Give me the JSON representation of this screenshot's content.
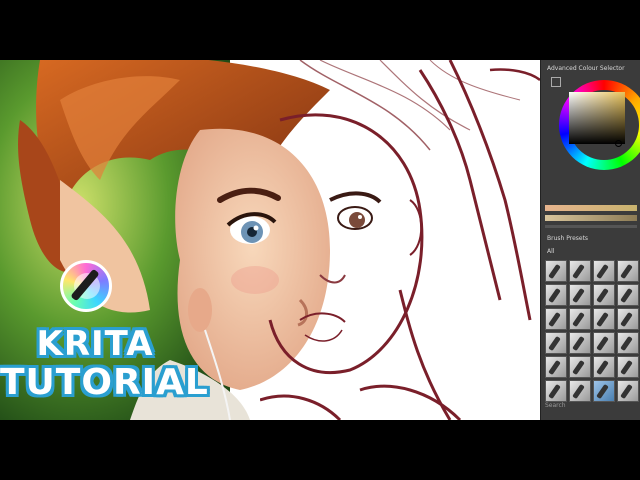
{
  "thumbnail": {
    "title_line1": "KRITA",
    "title_line2": "TUTORIAL"
  },
  "logo": {
    "icon": "krita-logo-icon"
  },
  "docker": {
    "color_selector_title": "Advanced Colour Selector",
    "brush_presets_title": "Brush Presets",
    "brush_presets_tag": "All",
    "search_placeholder": "Search",
    "selected_color": "#e9c35b"
  },
  "colors": {
    "title_outline": "#2a9fd0",
    "sketch_line": "#7a1f2a",
    "hair": "#b5521e",
    "skin": "#f2c9a6"
  }
}
